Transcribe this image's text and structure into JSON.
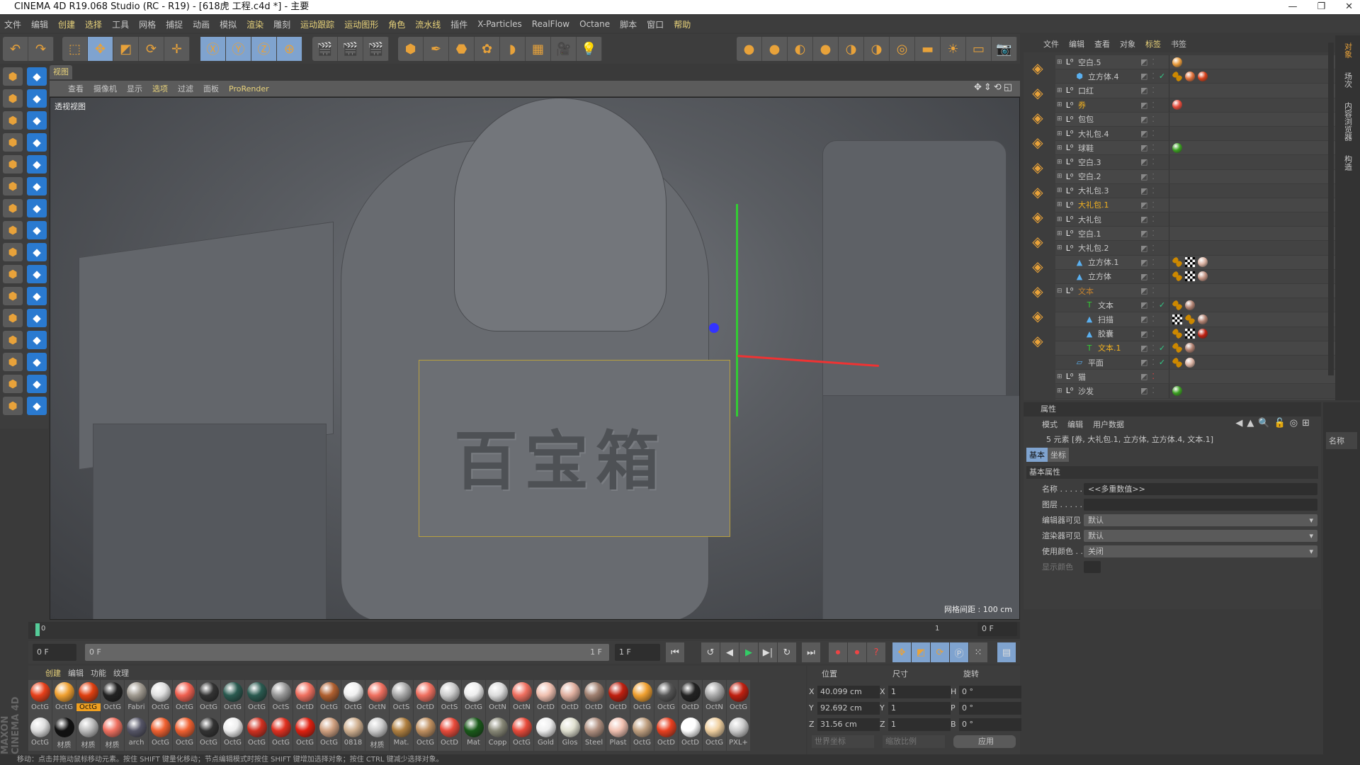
{
  "title": "CINEMA 4D R19.068 Studio (RC - R19) - [618虎 工程.c4d *] - 主要",
  "menu": [
    {
      "label": "文件"
    },
    {
      "label": "编辑"
    },
    {
      "label": "创建",
      "hl": true
    },
    {
      "label": "选择",
      "hl": true
    },
    {
      "label": "工具"
    },
    {
      "label": "网格"
    },
    {
      "label": "捕捉"
    },
    {
      "label": "动画"
    },
    {
      "label": "模拟"
    },
    {
      "label": "渲染",
      "hl": true
    },
    {
      "label": "雕刻"
    },
    {
      "label": "运动跟踪",
      "hl": true
    },
    {
      "label": "运动图形",
      "hl": true
    },
    {
      "label": "角色",
      "hl": true
    },
    {
      "label": "流水线",
      "hl": true
    },
    {
      "label": "插件"
    },
    {
      "label": "X-Particles"
    },
    {
      "label": "RealFlow"
    },
    {
      "label": "Octane"
    },
    {
      "label": "脚本"
    },
    {
      "label": "窗口"
    },
    {
      "label": "帮助",
      "hl": true
    }
  ],
  "toolbar": {
    "groups": [
      [
        {
          "icon": "undo-icon",
          "g": "↶"
        },
        {
          "icon": "redo-icon",
          "g": "↷"
        }
      ],
      [
        {
          "icon": "live-selection-icon",
          "g": "⬚"
        },
        {
          "icon": "move-icon",
          "g": "✥",
          "sel": true
        },
        {
          "icon": "scale-icon",
          "g": "◩"
        },
        {
          "icon": "rotate-icon",
          "g": "⟳"
        },
        {
          "icon": "recent-tool-icon",
          "g": "✛"
        }
      ],
      [
        {
          "icon": "x-axis-icon",
          "g": "Ⓧ",
          "sel": true
        },
        {
          "icon": "y-axis-icon",
          "g": "Ⓨ",
          "sel": true
        },
        {
          "icon": "z-axis-icon",
          "g": "Ⓩ",
          "sel": true
        },
        {
          "icon": "world-coord-icon",
          "g": "⊕",
          "sel": true
        }
      ],
      [
        {
          "icon": "render-view-icon",
          "g": "🎬"
        },
        {
          "icon": "render-picture-viewer-icon",
          "g": "🎬"
        },
        {
          "icon": "render-settings-icon",
          "g": "🎬"
        }
      ],
      [
        {
          "icon": "cube-icon",
          "g": "⬢"
        },
        {
          "icon": "pen-icon",
          "g": "✒"
        },
        {
          "icon": "subdivision-icon",
          "g": "⬣"
        },
        {
          "icon": "cloner-icon",
          "g": "✿"
        },
        {
          "icon": "deformer-icon",
          "g": "◗"
        },
        {
          "icon": "floor-icon",
          "g": "▦"
        },
        {
          "icon": "camera-icon",
          "g": "🎥"
        },
        {
          "icon": "light-icon",
          "g": "💡"
        }
      ],
      [
        {
          "icon": "octane-material-icon",
          "g": "●"
        },
        {
          "icon": "octane-diffuse-icon",
          "g": "●"
        },
        {
          "icon": "octane-glossy-icon",
          "g": "◐"
        },
        {
          "icon": "octane-specular-icon",
          "g": "●"
        },
        {
          "icon": "octane-mix-icon",
          "g": "◑"
        },
        {
          "icon": "octane-portal-icon",
          "g": "◑"
        },
        {
          "icon": "octane-area-light-icon",
          "g": "◎"
        },
        {
          "icon": "octane-ies-light-icon",
          "g": "▬"
        },
        {
          "icon": "octane-sun-icon",
          "g": "☀"
        },
        {
          "icon": "octane-light-plane-icon",
          "g": "▭"
        },
        {
          "icon": "octane-camera-icon",
          "g": "📷"
        }
      ]
    ]
  },
  "viewport": {
    "tab": "视图",
    "menu": [
      {
        "label": "查看"
      },
      {
        "label": "摄像机"
      },
      {
        "label": "显示"
      },
      {
        "label": "选项",
        "hl": true
      },
      {
        "label": "过滤"
      },
      {
        "label": "面板"
      },
      {
        "label": "ProRender",
        "hl": true
      }
    ],
    "label": "透视视图",
    "grid": "网格间距 : 100 cm",
    "scene_text": "百宝箱"
  },
  "objmgr": {
    "menu": [
      {
        "label": "文件"
      },
      {
        "label": "编辑"
      },
      {
        "label": "查看"
      },
      {
        "label": "对象"
      },
      {
        "label": "标签",
        "hl": true
      },
      {
        "label": "书签"
      }
    ],
    "objects": [
      {
        "name": "空白.5",
        "lvl": 0,
        "type": "null",
        "tags": [
          "#e89a3a"
        ]
      },
      {
        "name": "立方体.4",
        "lvl": 1,
        "type": "cube",
        "check": true,
        "tags": [
          "phong",
          "#e0703a",
          "#d8401a"
        ]
      },
      {
        "name": "口红",
        "lvl": 0,
        "type": "null",
        "tags": []
      },
      {
        "name": "券",
        "lvl": 0,
        "type": "null",
        "sel": true,
        "tags": [
          "#e84a3a"
        ]
      },
      {
        "name": "包包",
        "lvl": 0,
        "type": "null",
        "tags": []
      },
      {
        "name": "大礼包.4",
        "lvl": 0,
        "type": "null",
        "tags": []
      },
      {
        "name": "球鞋",
        "lvl": 0,
        "type": "null",
        "tags": [
          "#3aa020"
        ]
      },
      {
        "name": "空白.3",
        "lvl": 0,
        "type": "null",
        "tags": []
      },
      {
        "name": "空白.2",
        "lvl": 0,
        "type": "null",
        "tags": []
      },
      {
        "name": "大礼包.3",
        "lvl": 0,
        "type": "null",
        "tags": []
      },
      {
        "name": "大礼包.1",
        "lvl": 0,
        "type": "null",
        "sel": true,
        "tags": []
      },
      {
        "name": "大礼包",
        "lvl": 0,
        "type": "null",
        "tags": []
      },
      {
        "name": "空白.1",
        "lvl": 0,
        "type": "null",
        "tags": []
      },
      {
        "name": "大礼包.2",
        "lvl": 0,
        "type": "null",
        "tags": []
      },
      {
        "name": "立方体.1",
        "lvl": 1,
        "type": "poly",
        "tags": [
          "phong",
          "uvw",
          "#d8b0a0"
        ]
      },
      {
        "name": "立方体",
        "lvl": 1,
        "type": "poly",
        "tags": [
          "phong",
          "uvw",
          "#c09080"
        ]
      },
      {
        "name": "文本",
        "lvl": 0,
        "type": "null",
        "open": true,
        "dim": true,
        "tags": []
      },
      {
        "name": "文本",
        "lvl": 2,
        "type": "text",
        "check": true,
        "tags": [
          "phong",
          "#b08070"
        ]
      },
      {
        "name": "扫描",
        "lvl": 2,
        "type": "poly",
        "tags": [
          "uvw",
          "phong",
          "#b08070"
        ]
      },
      {
        "name": "胶囊",
        "lvl": 2,
        "type": "poly",
        "tags": [
          "phong",
          "uvw",
          "#c02010"
        ]
      },
      {
        "name": "文本.1",
        "lvl": 2,
        "type": "text",
        "check": true,
        "sel": true,
        "tags": [
          "phong",
          "#b08070"
        ]
      },
      {
        "name": "平面",
        "lvl": 1,
        "type": "plane",
        "check": true,
        "tags": [
          "phong",
          "#d8b0a0"
        ]
      },
      {
        "name": "猫",
        "lvl": 0,
        "type": "null",
        "red": true,
        "tags": []
      },
      {
        "name": "沙发",
        "lvl": 0,
        "type": "null",
        "tags": [
          "#3aa020"
        ]
      }
    ]
  },
  "side_tabs": [
    {
      "label": "对象",
      "hl": true
    },
    {
      "label": "场次"
    },
    {
      "label": "内容浏览器"
    },
    {
      "label": "构造"
    }
  ],
  "attributes": {
    "header": "属性",
    "menu": [
      "模式",
      "编辑",
      "用户数据"
    ],
    "selection": "5 元素 [券, 大礼包.1, 立方体, 立方体.4, 文本.1]",
    "tabs": [
      {
        "label": "基本",
        "sel": true
      },
      {
        "label": "坐标"
      }
    ],
    "section": "基本属性",
    "fields": [
      {
        "label": "名称 . . . . .",
        "value": "<<多重数值>>",
        "kind": "text"
      },
      {
        "label": "图层 . . . . .",
        "value": "",
        "kind": "text"
      },
      {
        "label": "编辑器可见",
        "value": "默认",
        "kind": "dd"
      },
      {
        "label": "渲染器可见",
        "value": "默认",
        "kind": "dd"
      },
      {
        "label": "使用颜色 . .",
        "value": "关闭",
        "kind": "dd"
      },
      {
        "label": "显示颜色",
        "value": "",
        "kind": "color"
      }
    ],
    "side_label": "名称"
  },
  "timeline": {
    "start": "0",
    "end_mark": "1",
    "current": "0 F",
    "range_start": "0 F",
    "range_field": "0 F",
    "range_end": "1 F",
    "end_field": "1 F"
  },
  "materials": {
    "menu": [
      {
        "label": "创建",
        "hl": true
      },
      {
        "label": "编辑"
      },
      {
        "label": "功能"
      },
      {
        "label": "纹理"
      }
    ],
    "items": [
      [
        "OctG",
        "#e8401a"
      ],
      [
        "OctG",
        "#f0a030"
      ],
      [
        "OctG",
        "#e04010",
        true
      ],
      [
        "OctG",
        "#222"
      ],
      [
        "Fabri",
        "#a09a90"
      ],
      [
        "OctG",
        "#e0e0e0"
      ],
      [
        "OctG",
        "#f06050"
      ],
      [
        "OctG",
        "#333"
      ],
      [
        "OctG",
        "#2a5a50"
      ],
      [
        "OctG",
        "#2a5a50"
      ],
      [
        "OctS",
        "#999"
      ],
      [
        "OctD",
        "#f07060"
      ],
      [
        "OctG",
        "#b06030"
      ],
      [
        "OctG",
        "#f0f0f0"
      ],
      [
        "OctN",
        "#f07060"
      ],
      [
        "OctS",
        "#aaa"
      ],
      [
        "OctD",
        "#f07060"
      ],
      [
        "OctS",
        "#ccc"
      ],
      [
        "OctG",
        "#eee"
      ],
      [
        "OctN",
        "#ddd"
      ],
      [
        "OctN",
        "#f07060"
      ],
      [
        "OctD",
        "#f0c0b0"
      ],
      [
        "OctD",
        "#e0b0a0"
      ],
      [
        "OctD",
        "#a08070"
      ],
      [
        "OctD",
        "#c02010"
      ],
      [
        "OctG",
        "#f0a030"
      ],
      [
        "OctG",
        "#555"
      ],
      [
        "OctD",
        "#222"
      ],
      [
        "OctN",
        "#aaa"
      ],
      [
        "OctG",
        "#c02010"
      ],
      [
        "OctG",
        "#ddd"
      ],
      [
        "材质",
        "#111"
      ],
      [
        "材质",
        "#bbb"
      ],
      [
        "材质",
        "#f07060"
      ],
      [
        "arch",
        "#556"
      ],
      [
        "OctG",
        "#f06030"
      ],
      [
        "OctG",
        "#f06030"
      ],
      [
        "OctG",
        "#333"
      ],
      [
        "OctG",
        "#eee"
      ],
      [
        "OctG",
        "#d03020"
      ],
      [
        "OctG",
        "#e03020"
      ],
      [
        "OctG",
        "#e02010"
      ],
      [
        "OctG",
        "#d0a080"
      ],
      [
        "0818",
        "#d0b090"
      ],
      [
        "材质",
        "#ccc"
      ],
      [
        "Mat.",
        "#b08040"
      ],
      [
        "OctG",
        "#c09060"
      ],
      [
        "OctD",
        "#e84a3a"
      ],
      [
        "Mat",
        "#1a5a1a"
      ],
      [
        "Copp",
        "#887"
      ],
      [
        "OctG",
        "#e84a3a"
      ],
      [
        "Gold",
        "#eee"
      ],
      [
        "Glos",
        "#e0e0d0"
      ],
      [
        "Steel",
        "#b09080"
      ],
      [
        "Plast",
        "#f0c0b0"
      ],
      [
        "OctG",
        "#c0a080"
      ],
      [
        "OctD",
        "#e84020"
      ],
      [
        "OctD",
        "#fff"
      ],
      [
        "OctG",
        "#f0d0a0"
      ],
      [
        "PXL+",
        "#ccc"
      ]
    ]
  },
  "coords": {
    "headers": [
      "位置",
      "尺寸",
      "旋转"
    ],
    "rows": [
      [
        "X",
        "40.099 cm",
        "X",
        "1",
        "H",
        "0 °"
      ],
      [
        "Y",
        "92.692 cm",
        "Y",
        "1",
        "P",
        "0 °"
      ],
      [
        "Z",
        "31.56 cm",
        "Z",
        "1",
        "B",
        "0 °"
      ]
    ],
    "coord_mode": "世界坐标",
    "scale_mode": "缩放比例",
    "apply": "应用"
  },
  "brand": "MAXON CINEMA 4D",
  "status": "移动：点击并拖动鼠标移动元素。按住 SHIFT 键量化移动；节点编辑模式时按住 SHIFT 键增加选择对象；按住 CTRL 键减少选择对象。",
  "colors": {
    "accent": "#e8d27a",
    "selected_blue": "#7fa3cf",
    "selected_orange": "#f0a020"
  }
}
